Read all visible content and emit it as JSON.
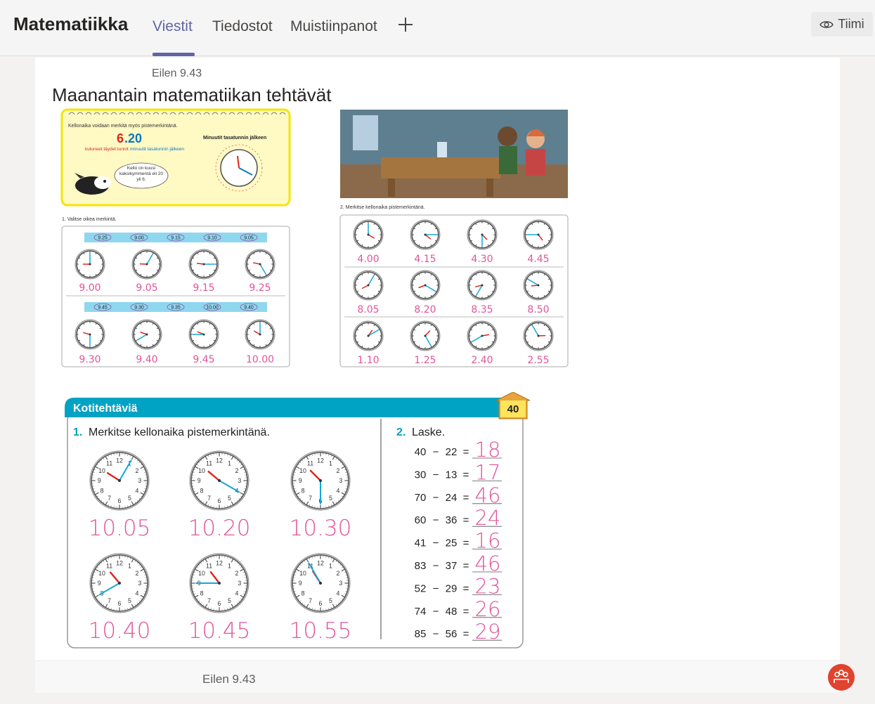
{
  "header": {
    "title": "Matematiikka",
    "tabs": [
      {
        "label": "Viestit",
        "active": true
      },
      {
        "label": "Tiedostot",
        "active": false
      },
      {
        "label": "Muistiinpanot",
        "active": false
      }
    ],
    "add_icon": "plus-icon",
    "team_button": {
      "icon": "eye-icon",
      "label": "Tiimi"
    }
  },
  "post": {
    "timestamp": "Eilen 9.43",
    "title": "Maanantain matematiikan tehtävät"
  },
  "sheet_left": {
    "info_text": "Kellonaika voidaan merkitä myös pistemerkintänä.",
    "big_time_hours": "6",
    "big_time_minutes": ".20",
    "label_hours": "kuluneet täydet tunnit",
    "label_minutes": "minuutit tasatunnin jälkeen",
    "speech": "Kello on kuusi kaksikymmentä eli 20 yli 6.",
    "minute_dial_title": "Minuutit tasatunnin jälkeen",
    "exercise": "1. Valitse oikea merkintä.",
    "row1_options": [
      "9.25",
      "9.00",
      "9.15",
      "9.10",
      "9.05"
    ],
    "row1_answers": [
      "9.00",
      "9.05",
      "9.15",
      "9.25"
    ],
    "row2_options": [
      "9.45",
      "9.30",
      "9.35",
      "10.00",
      "9.40"
    ],
    "row2_answers": [
      "9.30",
      "9.40",
      "9.45",
      "10.00"
    ]
  },
  "sheet_right": {
    "exercise": "2. Merkitse kellonaika pistemerkintänä.",
    "answers": [
      "4.00",
      "4.15",
      "4.30",
      "4.45",
      "8.05",
      "8.20",
      "8.35",
      "8.50",
      "1.10",
      "1.25",
      "2.40",
      "2.55"
    ]
  },
  "homework": {
    "banner": "Kotitehtäviä",
    "page_number": "40",
    "task1_num": "1.",
    "task1_title": "Merkitse kellonaika pistemerkintänä.",
    "clock_answers": [
      "10.05",
      "10.20",
      "10.30",
      "10.40",
      "10.45",
      "10.55"
    ],
    "task2_num": "2.",
    "task2_title": "Laske.",
    "subtractions": [
      {
        "a": "40",
        "b": "22",
        "answer": "18"
      },
      {
        "a": "30",
        "b": "13",
        "answer": "17"
      },
      {
        "a": "70",
        "b": "24",
        "answer": "46"
      },
      {
        "a": "60",
        "b": "36",
        "answer": "24"
      },
      {
        "a": "41",
        "b": "25",
        "answer": "16"
      },
      {
        "a": "83",
        "b": "37",
        "answer": "46"
      },
      {
        "a": "52",
        "b": "29",
        "answer": "23"
      },
      {
        "a": "74",
        "b": "48",
        "answer": "26"
      },
      {
        "a": "85",
        "b": "56",
        "answer": "29"
      }
    ]
  },
  "footer": {
    "timestamp": "Eilen 9.43",
    "reply_icon": "team-reply-icon"
  },
  "colors": {
    "accent": "#6264a7",
    "banner": "#00a3c4",
    "handwriting": "#e0569b",
    "reply": "#e0432f"
  }
}
